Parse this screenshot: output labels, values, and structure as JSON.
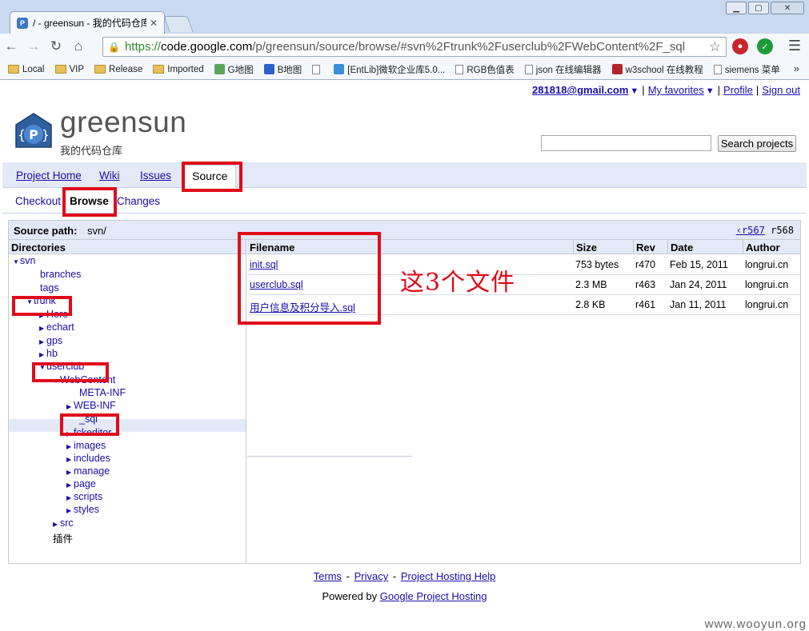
{
  "browser": {
    "tab_title": "/ - greensun - 我的代码仓库",
    "tab_favicon": "P",
    "url": {
      "scheme": "https://",
      "domain": "code.google.com",
      "path": "/p/greensun/source/browse/#svn%2Ftrunk%2Fuserclub%2FWebContent%2F_sql"
    },
    "bookmarks": [
      {
        "label": "Local",
        "icon": "folder-icon"
      },
      {
        "label": "VIP",
        "icon": "folder-icon"
      },
      {
        "label": "Release",
        "icon": "folder-icon"
      },
      {
        "label": "Imported",
        "icon": "folder-icon"
      },
      {
        "label": "G地图",
        "icon": "map-icon"
      },
      {
        "label": "B地图",
        "icon": "paw-icon"
      },
      {
        "label": "",
        "icon": "page-icon"
      },
      {
        "label": "[EntLib]微软企业库5.0...",
        "icon": "ie-icon"
      },
      {
        "label": "RGB色值表",
        "icon": "page-icon"
      },
      {
        "label": "json 在线编辑器",
        "icon": "page-icon"
      },
      {
        "label": "w3school 在线教程",
        "icon": "w3-icon"
      },
      {
        "label": "siemens 菜单",
        "icon": "page-icon"
      }
    ],
    "bookmarks_more": "»"
  },
  "userbar": {
    "email": "281818@gmail.com",
    "my_favorites": "My favorites",
    "profile": "Profile",
    "sign_out": "Sign out"
  },
  "project": {
    "name": "greensun",
    "summary": "我的代码仓库",
    "logo_letter": "P",
    "search_button": "Search projects",
    "search_value": ""
  },
  "main_tabs": [
    {
      "label": "Project Home"
    },
    {
      "label": "Wiki"
    },
    {
      "label": "Issues"
    },
    {
      "label": "Source"
    }
  ],
  "sub_tabs": [
    {
      "label": "Checkout"
    },
    {
      "label": "Browse"
    },
    {
      "label": "Changes"
    }
  ],
  "source": {
    "path_label": "Source path:",
    "path_value": "svn/",
    "prev_rev": "‹r567",
    "cur_rev": "r568",
    "directories_header": "Directories",
    "tree": [
      {
        "label": "svn",
        "expand": "open"
      },
      {
        "label": "branches",
        "expand": "none"
      },
      {
        "label": "tags",
        "expand": "none"
      },
      {
        "label": "trunk",
        "expand": "open"
      },
      {
        "label": "Here",
        "expand": "closed"
      },
      {
        "label": "echart",
        "expand": "closed"
      },
      {
        "label": "gps",
        "expand": "closed"
      },
      {
        "label": "hb",
        "expand": "closed"
      },
      {
        "label": "userclub",
        "expand": "open"
      },
      {
        "label": "WebContent",
        "expand": "open"
      },
      {
        "label": "META-INF",
        "expand": "none"
      },
      {
        "label": "WEB-INF",
        "expand": "closed"
      },
      {
        "label": "_sql",
        "expand": "none"
      },
      {
        "label": "fckeditor",
        "expand": "closed"
      },
      {
        "label": "images",
        "expand": "closed"
      },
      {
        "label": "includes",
        "expand": "closed"
      },
      {
        "label": "manage",
        "expand": "closed"
      },
      {
        "label": "page",
        "expand": "closed"
      },
      {
        "label": "scripts",
        "expand": "closed"
      },
      {
        "label": "styles",
        "expand": "closed"
      },
      {
        "label": "src",
        "expand": "closed"
      },
      {
        "label": "插件",
        "expand": "none"
      }
    ],
    "file_headers": {
      "filename": "Filename",
      "size": "Size",
      "rev": "Rev",
      "date": "Date",
      "author": "Author"
    },
    "files": [
      {
        "name": "init.sql",
        "size": "753 bytes",
        "rev": "r470",
        "date": "Feb 15, 2011",
        "author": "longrui.cn"
      },
      {
        "name": "userclub.sql",
        "size": "2.3 MB",
        "rev": "r463",
        "date": "Jan 24, 2011",
        "author": "longrui.cn"
      },
      {
        "name": "用户信息及积分导入.sql",
        "size": "2.8 KB",
        "rev": "r461",
        "date": "Jan 11, 2011",
        "author": "longrui.cn"
      }
    ]
  },
  "annotation": "这3个文件",
  "footer": {
    "terms": "Terms",
    "privacy": "Privacy",
    "help": "Project Hosting Help",
    "powered_prefix": "Powered by",
    "powered_link": "Google Project Hosting"
  },
  "watermark": "www.wooyun.org",
  "colors": {
    "highlight": "#e00b1a",
    "link": "#1a0dab",
    "header_bg": "#e3e9f6"
  }
}
